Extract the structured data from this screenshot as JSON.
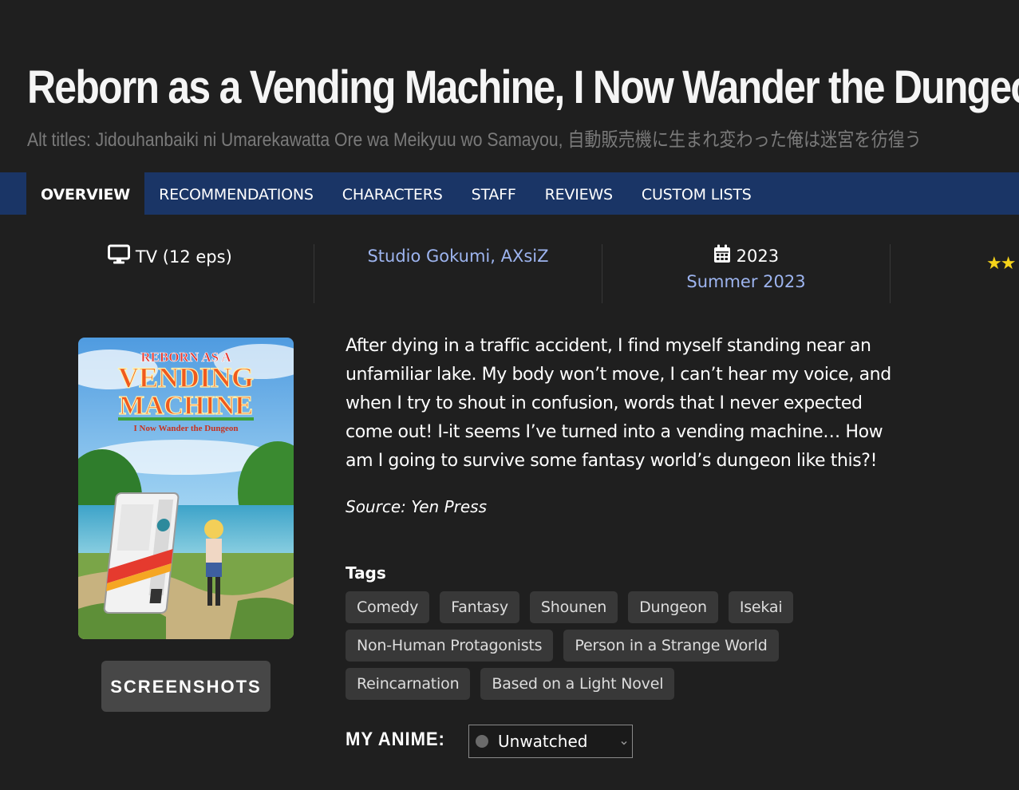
{
  "anime": {
    "title": "Reborn as a Vending Machine, I Now Wander the Dungeon",
    "alt_titles": "Alt titles: Jidouhanbaiki ni Umarekawatta Ore wa Meikyuu wo Samayou, 自動販売機に生まれ変わった俺は迷宮を彷徨う"
  },
  "nav": {
    "tabs": [
      {
        "label": "OVERVIEW",
        "active": true
      },
      {
        "label": "RECOMMENDATIONS"
      },
      {
        "label": "CHARACTERS"
      },
      {
        "label": "STAFF"
      },
      {
        "label": "REVIEWS"
      },
      {
        "label": "CUSTOM LISTS"
      }
    ]
  },
  "info": {
    "format_icon": "monitor-icon",
    "format": "TV (12 eps)",
    "studios": "Studio Gokumi, AXsiZ",
    "year_icon": "calendar-icon",
    "year": "2023",
    "season": "Summer 2023",
    "rating_stars": "★★"
  },
  "poster": {
    "title_line1": "REBORN AS A",
    "title_line2": "VENDING",
    "title_line3": "MACHINE",
    "subtitle": "I Now Wander the Dungeon"
  },
  "screenshots_label": "SCREENSHOTS",
  "synopsis": "After dying in a traffic accident, I find myself standing near an unfamiliar lake. My body won’t move, I can’t hear my voice, and when I try to shout in confusion, words that I never expected come out! I-it seems I’ve turned into a vending machine… How am I going to survive some fantasy world’s dungeon like this?!",
  "source": "Source: Yen Press",
  "tags_heading": "Tags",
  "tags": [
    [
      "Comedy",
      "Fantasy",
      "Shounen",
      "Dungeon",
      "Isekai"
    ],
    [
      "Non-Human Protagonists",
      "Person in a Strange World"
    ],
    [
      "Reincarnation",
      "Based on a Light Novel"
    ]
  ],
  "my_anime": {
    "label": "MY ANIME:",
    "status": "Unwatched"
  },
  "colors": {
    "background": "#1f1f1f",
    "nav": "#1a3566",
    "link": "#9db4ef",
    "tag": "#383838",
    "star": "#f5d31a"
  }
}
